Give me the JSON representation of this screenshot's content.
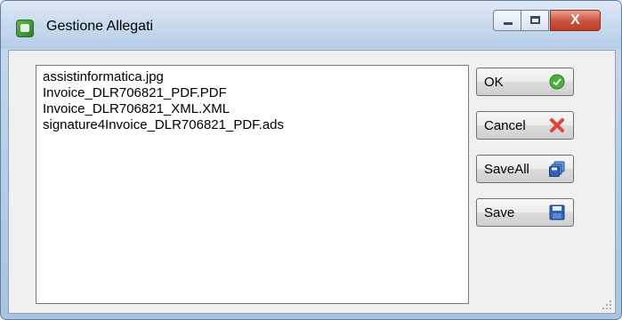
{
  "window": {
    "title": "Gestione Allegati",
    "controls": {
      "minimize": "–",
      "maximize": "□",
      "close": "X"
    }
  },
  "files": [
    "assistinformatica.jpg",
    "Invoice_DLR706821_PDF.PDF",
    "Invoice_DLR706821_XML.XML",
    "signature4Invoice_DLR706821_PDF.ads"
  ],
  "buttons": {
    "ok": "OK",
    "cancel": "Cancel",
    "saveall": "SaveAll",
    "save": "Save"
  },
  "icons": {
    "ok": "checkmark-circle-green",
    "cancel": "red-x",
    "saveall": "stacked-floppy-disks",
    "save": "floppy-disk"
  },
  "colors": {
    "ok_icon": "#4cae3c",
    "cancel_icon": "#e0453b",
    "save_icon": "#2f63b8"
  }
}
